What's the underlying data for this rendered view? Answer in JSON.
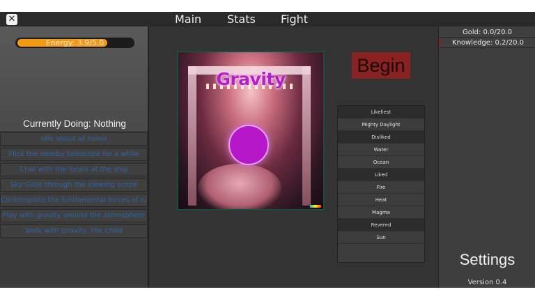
{
  "topbar": {
    "close_label": "✕",
    "tabs": [
      {
        "label": "Main"
      },
      {
        "label": "Stats"
      },
      {
        "label": "Fight"
      }
    ]
  },
  "energy": {
    "label": "Energy: 3.9/5.0",
    "current": 3.9,
    "max": 5.0,
    "fill_color": "#f39a12"
  },
  "status": {
    "currently_doing": "Currently Doing: Nothing"
  },
  "tasks": [
    {
      "label": "Idle about at home"
    },
    {
      "label": "Flick the nearby telescope for a while"
    },
    {
      "label": "Chat with the locals at the ship"
    },
    {
      "label": "Sky Gaze through the viewing scope"
    },
    {
      "label": "Contemplate the fundamental forces of nature"
    },
    {
      "label": "Play with gravity around the atmosphere"
    },
    {
      "label": "Walk with Gravity, the Child"
    }
  ],
  "card": {
    "title": "Gravity",
    "orb_color": "#b617c9"
  },
  "begin_button": {
    "label": "Begin",
    "color": "#8b2222"
  },
  "preferences": [
    {
      "label": "Likeliest",
      "header": true
    },
    {
      "label": "Mighty Daylight",
      "header": false
    },
    {
      "label": "Disliked",
      "header": true
    },
    {
      "label": "Water",
      "header": false
    },
    {
      "label": "Ocean",
      "header": false
    },
    {
      "label": "Liked",
      "header": true
    },
    {
      "label": "Fire",
      "header": false
    },
    {
      "label": "Heat",
      "header": false
    },
    {
      "label": "Magma",
      "header": false
    },
    {
      "label": "Revered",
      "header": true
    },
    {
      "label": "Sun",
      "header": false
    }
  ],
  "resources": {
    "gold": "Gold: 0.0/20.0",
    "knowledge": "Knowledge: 0.2/20.0"
  },
  "settings_label": "Settings",
  "version": "Version 0.4",
  "icons": {
    "close": "close-icon"
  }
}
